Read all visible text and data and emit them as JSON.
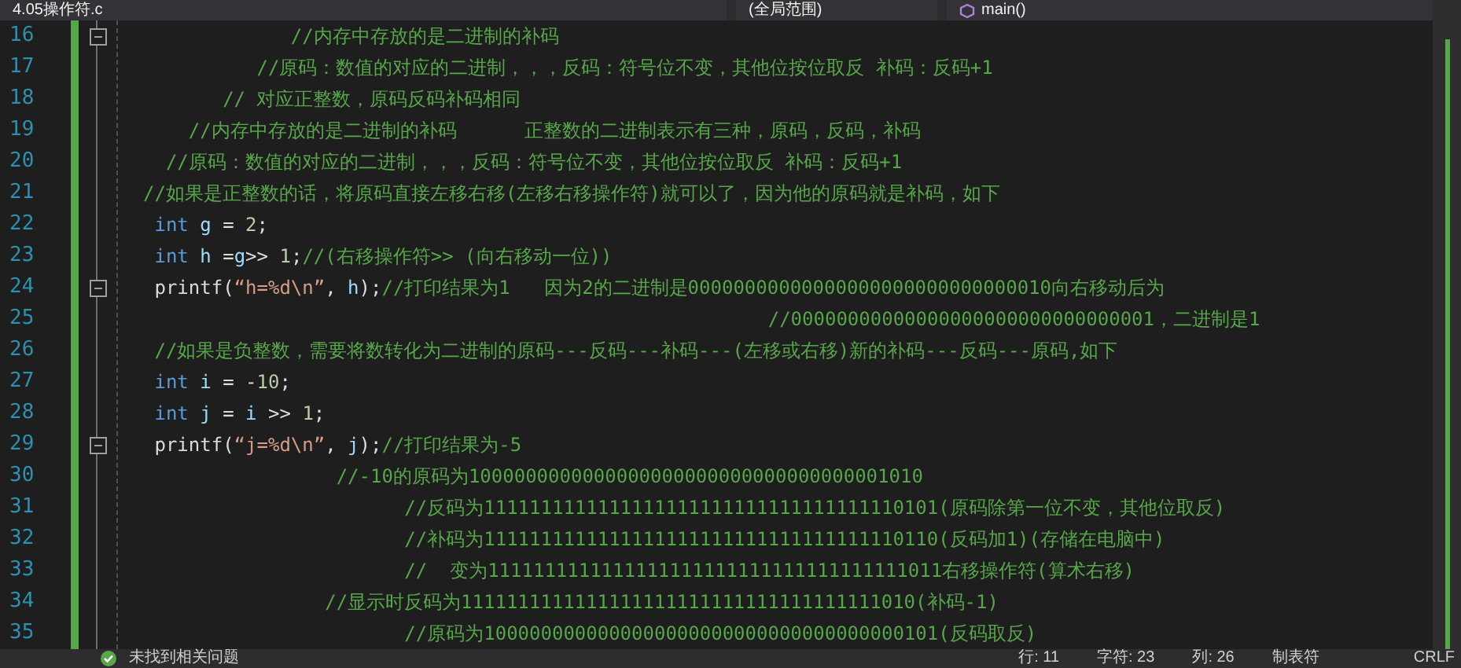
{
  "navigation_bar": [
    {
      "label": "4.05操作符.c",
      "kind": "file"
    },
    {
      "label": "(全局范围)",
      "kind": "scope"
    },
    {
      "label": "main()",
      "kind": "function"
    }
  ],
  "lines": [
    {
      "number": "16",
      "fold": true,
      "segments": [
        {
          "kind": "comment",
          "text": "             //内存中存放的是二进制的补码"
        }
      ]
    },
    {
      "number": "17",
      "fold": false,
      "segments": [
        {
          "kind": "comment",
          "text": "          //原码：数值的对应的二进制，，，反码：符号位不变，其他位按位取反 补码：反码+1"
        }
      ]
    },
    {
      "number": "18",
      "fold": false,
      "segments": [
        {
          "kind": "comment",
          "text": "       // 对应正整数，原码反码补码相同"
        }
      ]
    },
    {
      "number": "19",
      "fold": false,
      "segments": [
        {
          "kind": "comment",
          "text": "    //内存中存放的是二进制的补码      正整数的二进制表示有三种，原码，反码，补码"
        }
      ]
    },
    {
      "number": "20",
      "fold": false,
      "segments": [
        {
          "kind": "comment",
          "text": "  //原码：数值的对应的二进制，，，反码：符号位不变，其他位按位取反 补码：反码+1"
        }
      ]
    },
    {
      "number": "21",
      "fold": false,
      "segments": [
        {
          "kind": "comment",
          "text": "//如果是正整数的话，将原码直接左移右移(左移右移操作符)就可以了，因为他的原码就是补码，如下"
        }
      ]
    },
    {
      "number": "22",
      "fold": false,
      "segments": [
        {
          "kind": "keyword",
          "text": " int "
        },
        {
          "kind": "variable",
          "text": "g"
        },
        {
          "kind": "plain",
          "text": " = "
        },
        {
          "kind": "number",
          "text": "2"
        },
        {
          "kind": "plain",
          "text": ";"
        }
      ]
    },
    {
      "number": "23",
      "fold": false,
      "segments": [
        {
          "kind": "keyword",
          "text": " int "
        },
        {
          "kind": "variable",
          "text": "h"
        },
        {
          "kind": "plain",
          "text": " ="
        },
        {
          "kind": "variable",
          "text": "g"
        },
        {
          "kind": "plain",
          "text": ">> "
        },
        {
          "kind": "number",
          "text": "1"
        },
        {
          "kind": "plain",
          "text": ";"
        },
        {
          "kind": "comment",
          "text": "//(右移操作符>> (向右移动一位))"
        }
      ]
    },
    {
      "number": "24",
      "fold": true,
      "segments": [
        {
          "kind": "plain",
          "text": " printf("
        },
        {
          "kind": "string",
          "text": "“h=%d\\n”"
        },
        {
          "kind": "plain",
          "text": ", "
        },
        {
          "kind": "variable",
          "text": "h"
        },
        {
          "kind": "plain",
          "text": ");"
        },
        {
          "kind": "comment",
          "text": "//打印结果为1   因为2的二进制是00000000000000000000000000000010向右移动后为"
        }
      ]
    },
    {
      "number": "25",
      "fold": false,
      "segments": [
        {
          "kind": "comment",
          "text": "                                                       //00000000000000000000000000000001，二进制是1"
        }
      ]
    },
    {
      "number": "26",
      "fold": false,
      "segments": [
        {
          "kind": "comment",
          "text": " //如果是负整数，需要将数转化为二进制的原码---反码---补码---(左移或右移)新的补码---反码---原码,如下"
        }
      ]
    },
    {
      "number": "27",
      "fold": false,
      "segments": [
        {
          "kind": "keyword",
          "text": " int "
        },
        {
          "kind": "variable",
          "text": "i"
        },
        {
          "kind": "plain",
          "text": " = -"
        },
        {
          "kind": "number",
          "text": "10"
        },
        {
          "kind": "plain",
          "text": ";"
        }
      ]
    },
    {
      "number": "28",
      "fold": false,
      "segments": [
        {
          "kind": "keyword",
          "text": " int "
        },
        {
          "kind": "variable",
          "text": "j"
        },
        {
          "kind": "plain",
          "text": " = "
        },
        {
          "kind": "variable",
          "text": "i"
        },
        {
          "kind": "plain",
          "text": " >> "
        },
        {
          "kind": "number",
          "text": "1"
        },
        {
          "kind": "plain",
          "text": ";"
        }
      ]
    },
    {
      "number": "29",
      "fold": true,
      "segments": [
        {
          "kind": "plain",
          "text": " printf("
        },
        {
          "kind": "string",
          "text": "“j=%d\\n”"
        },
        {
          "kind": "plain",
          "text": ", "
        },
        {
          "kind": "variable",
          "text": "j"
        },
        {
          "kind": "plain",
          "text": ");"
        },
        {
          "kind": "comment",
          "text": "//打印结果为-5"
        }
      ]
    },
    {
      "number": "30",
      "fold": false,
      "segments": [
        {
          "kind": "comment",
          "text": "                 //-10的原码为1000000000000000000000000000000000001010"
        }
      ]
    },
    {
      "number": "31",
      "fold": false,
      "segments": [
        {
          "kind": "comment",
          "text": "                       //反码为1111111111111111111111111111111111110101(原码除第一位不变，其他位取反)"
        }
      ]
    },
    {
      "number": "32",
      "fold": false,
      "segments": [
        {
          "kind": "comment",
          "text": "                       //补码为1111111111111111111111111111111111110110(反码加1)(存储在电脑中)"
        }
      ]
    },
    {
      "number": "33",
      "fold": false,
      "segments": [
        {
          "kind": "comment",
          "text": "                       //  变为1111111111111111111111111111111111111011右移操作符(算术右移)"
        }
      ]
    },
    {
      "number": "34",
      "fold": false,
      "segments": [
        {
          "kind": "comment",
          "text": "                //显示时反码为1111111111111111111111111111111111111010(补码-1)"
        }
      ]
    },
    {
      "number": "35",
      "fold": false,
      "segments": [
        {
          "kind": "comment",
          "text": "                       //原码为1000000000000000000000000000000000000101(反码取反)"
        }
      ]
    }
  ],
  "status_bar": {
    "issues": "未找到相关问题",
    "line": "行: 11",
    "char": "字符: 23",
    "column": "列: 26",
    "indent": "制表符",
    "line_ending": "CRLF"
  }
}
